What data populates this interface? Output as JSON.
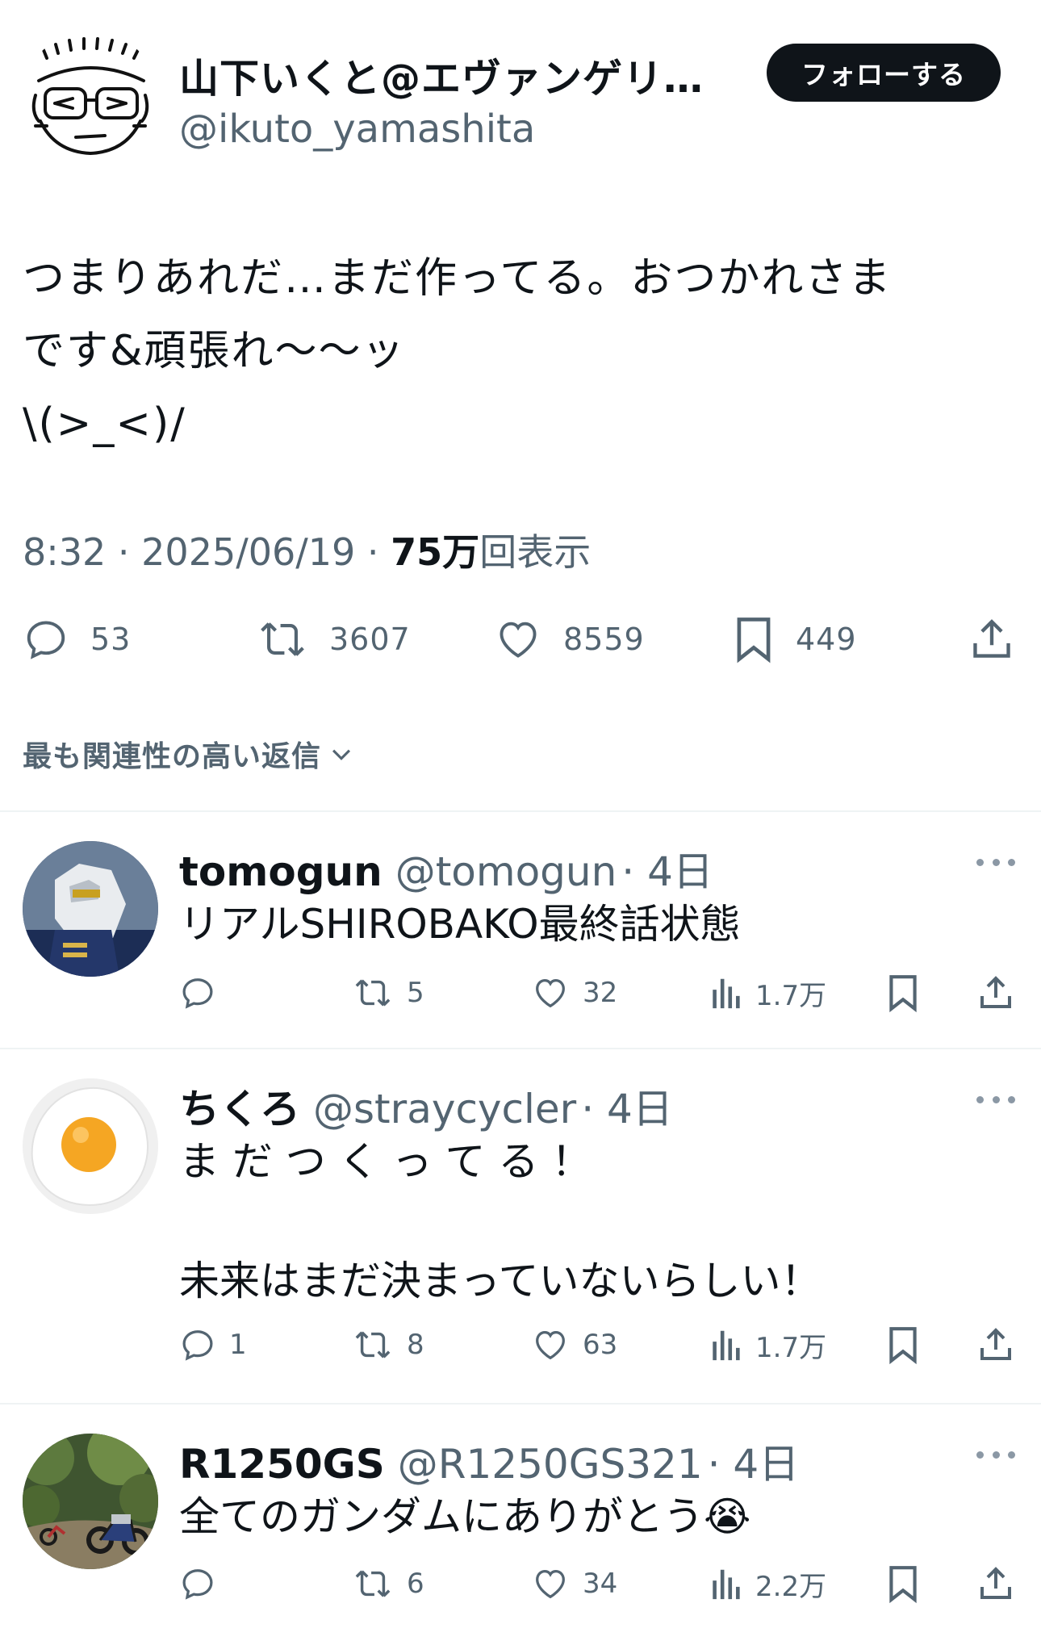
{
  "main_tweet": {
    "author_name": "山下いくと@エヴァンゲリ…",
    "author_handle": "@ikuto_yamashita",
    "follow_label": "フォローする",
    "text": "つまりあれだ…まだ作ってる。おつかれさま\nです&頑張れ〜〜ッ\n\\(>_<)/",
    "time": "8:32 · 2025/06/19 · ",
    "views_count": "75万",
    "views_label": "回表示",
    "replies": "53",
    "reposts": "3607",
    "likes": "8559",
    "bookmarks": "449"
  },
  "replies_sort": {
    "label": "最も関連性の高い返信"
  },
  "replies": [
    {
      "name": "tomogun",
      "handle": "@tomogun",
      "time": "· 4日",
      "text": "リアルSHIROBAKO最終話状態",
      "reply_count": "",
      "repost_count": "5",
      "like_count": "32",
      "view_count": "1.7万"
    },
    {
      "name": "ちくろ",
      "handle": "@straycycler",
      "time": "· 4日",
      "text": "ま だ つ く っ て る ！\n\n未来はまだ決まっていないらしい！",
      "reply_count": "1",
      "repost_count": "8",
      "like_count": "63",
      "view_count": "1.7万"
    },
    {
      "name": "R1250GS",
      "handle": "@R1250GS321",
      "time": "· 4日",
      "text": "全てのガンダムにありがとう😭",
      "reply_count": "",
      "repost_count": "6",
      "like_count": "34",
      "view_count": "2.2万"
    }
  ]
}
